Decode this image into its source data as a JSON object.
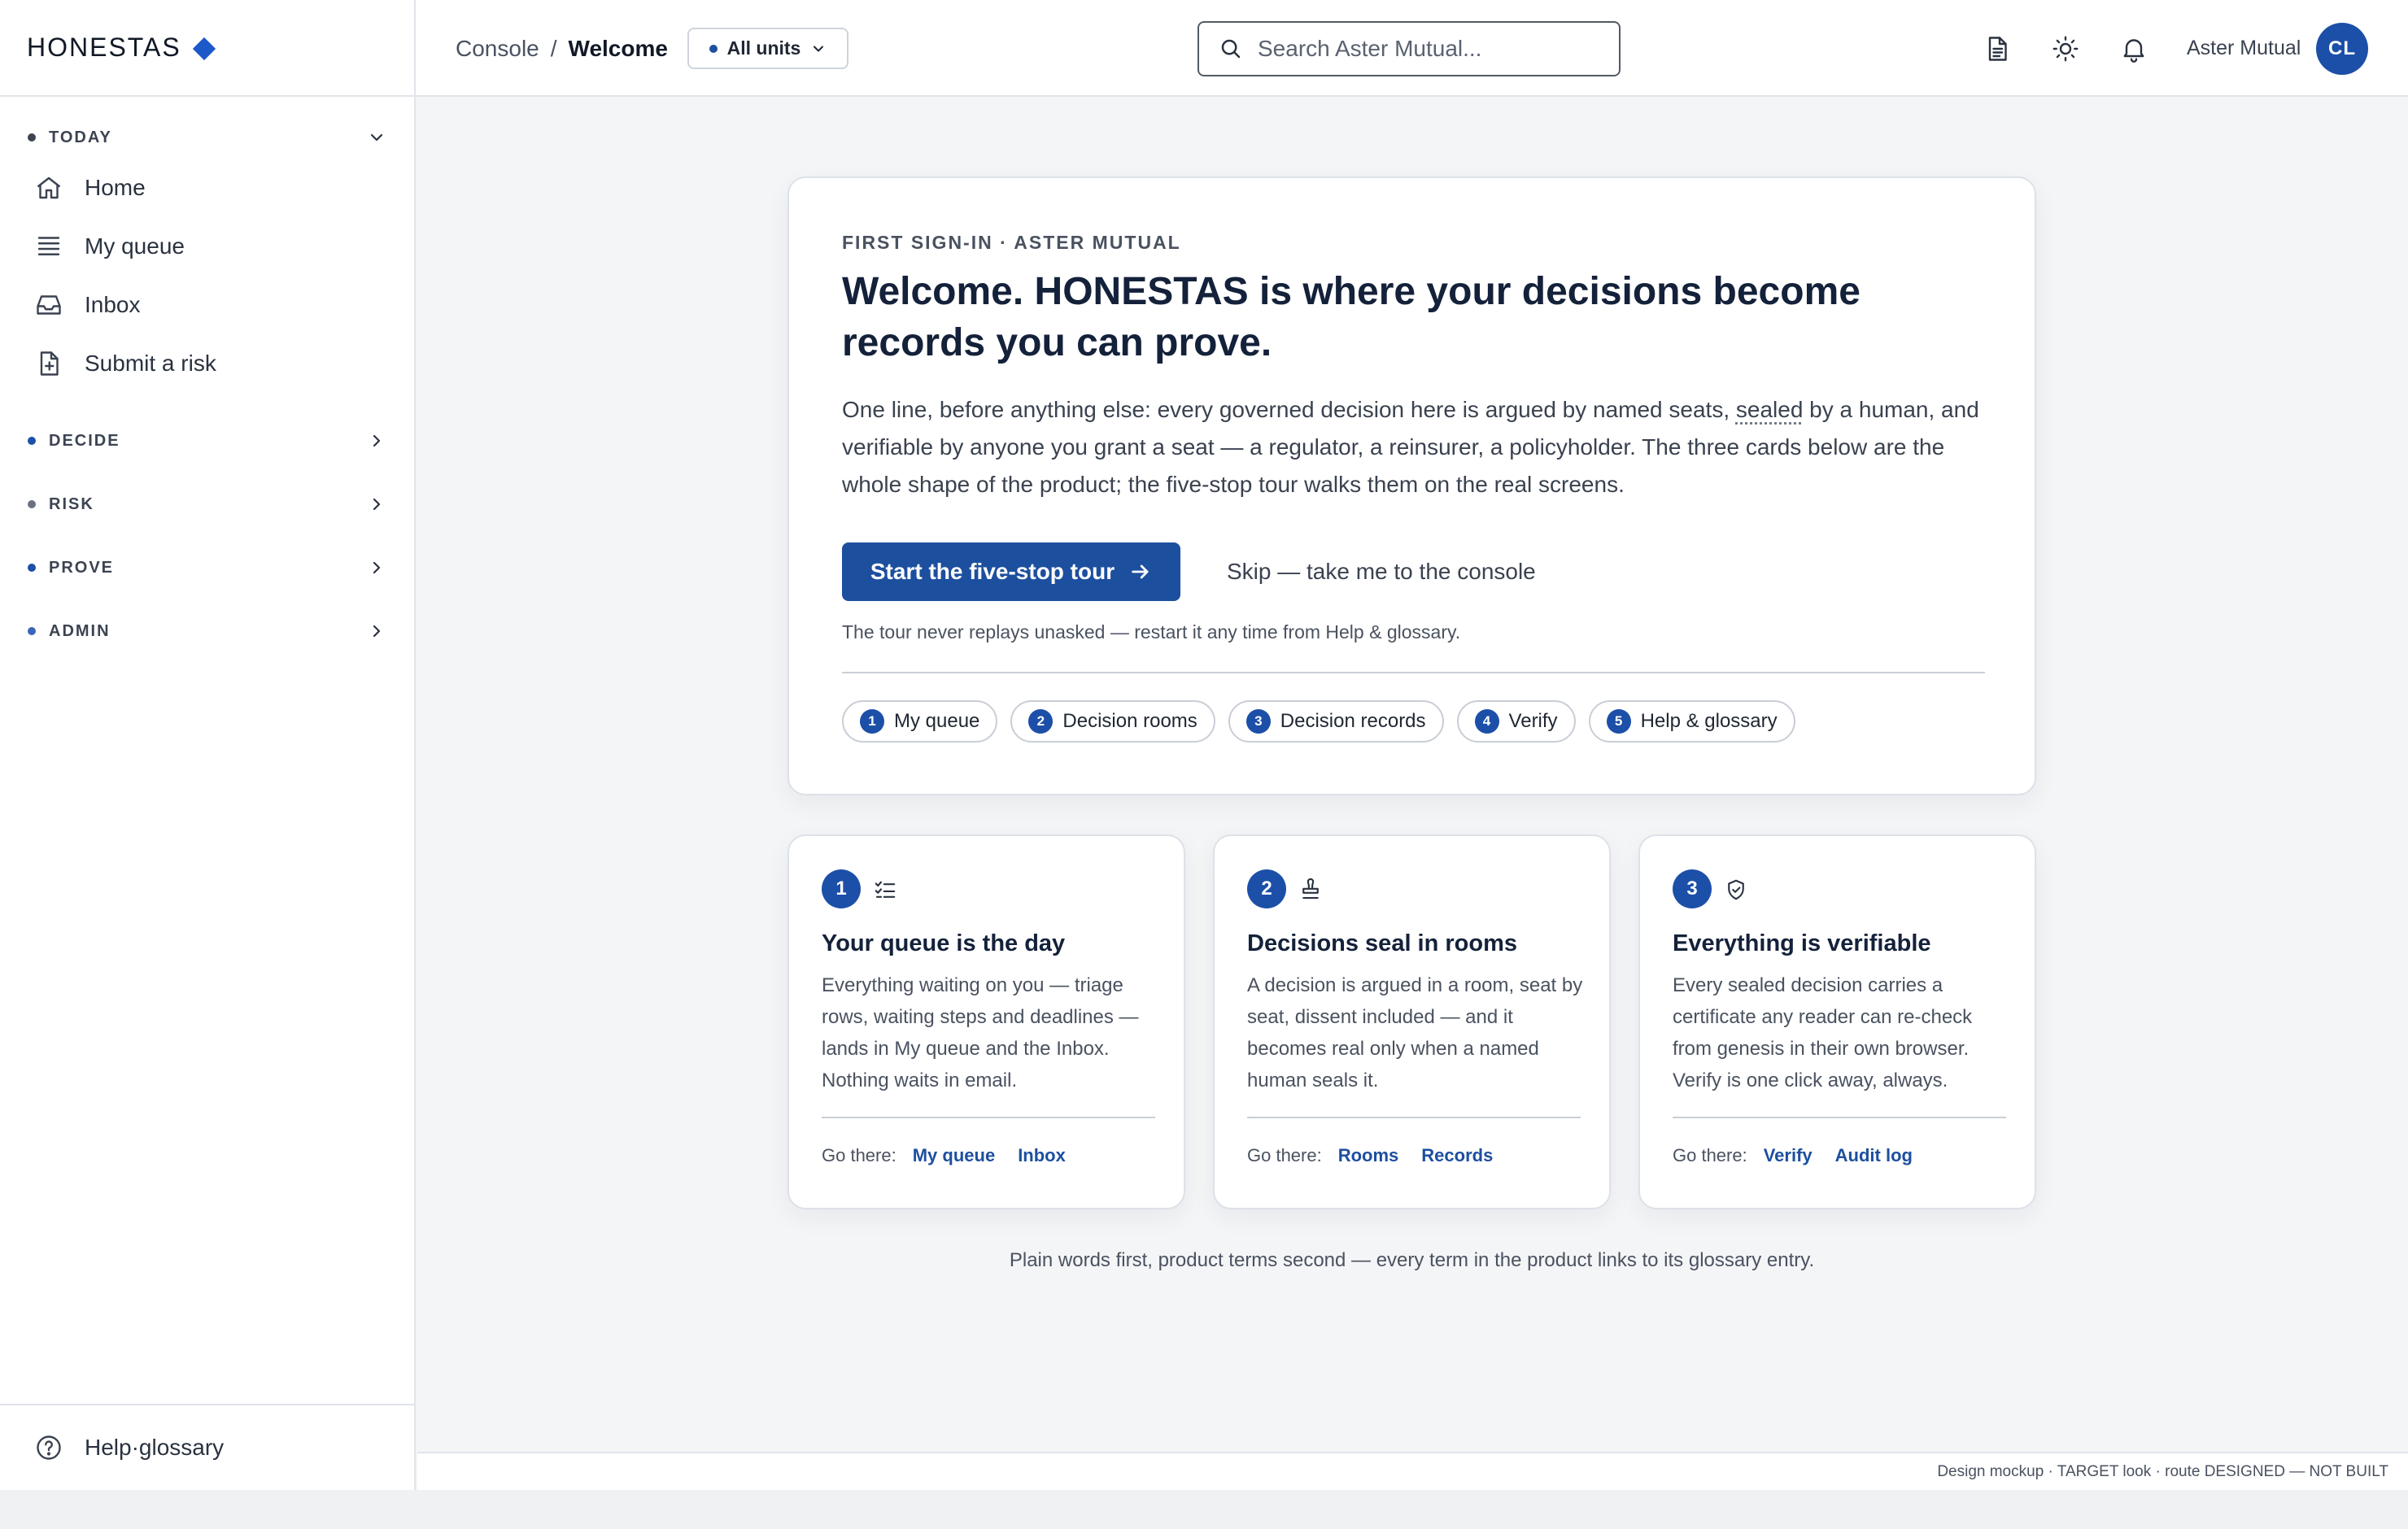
{
  "brand": {
    "name": "HONESTAS",
    "accent": "#1c58c8"
  },
  "sidebar": {
    "sections": [
      {
        "label": "TODAY",
        "dot_color": "#3c4452",
        "expanded": true,
        "items": [
          {
            "label": "Home",
            "icon": "home-icon"
          },
          {
            "label": "My queue",
            "icon": "queue-icon"
          },
          {
            "label": "Inbox",
            "icon": "inbox-icon"
          },
          {
            "label": "Submit a risk",
            "icon": "file-plus-icon"
          }
        ]
      },
      {
        "label": "DECIDE",
        "dot_color": "#1c4fa8",
        "expanded": false
      },
      {
        "label": "RISK",
        "dot_color": "#6a7280",
        "expanded": false
      },
      {
        "label": "PROVE",
        "dot_color": "#1c4fa8",
        "expanded": false
      },
      {
        "label": "ADMIN",
        "dot_color": "#3a66b8",
        "expanded": false
      }
    ],
    "footer": {
      "label": "Help·glossary",
      "icon": "help-circle-icon"
    }
  },
  "header": {
    "breadcrumb": {
      "root": "Console",
      "separator": "/",
      "current": "Welcome"
    },
    "unit_select": {
      "value": "All units"
    },
    "search": {
      "placeholder": "Search Aster Mutual..."
    },
    "icons": [
      "document-icon",
      "sun-icon",
      "bell-icon"
    ],
    "account": {
      "org": "Aster Mutual",
      "initials": "CL"
    }
  },
  "hero": {
    "eyebrow": "FIRST SIGN-IN · ASTER MUTUAL",
    "title": "Welcome. HONESTAS is where your decisions become records you can prove.",
    "body_before": "One line, before anything else: every governed decision here is argued by named seats, ",
    "body_term": "sealed",
    "body_after": " by a human, and verifiable by anyone you grant a seat — a regulator, a reinsurer, a policyholder. The three cards below are the whole shape of the product; the five-stop tour walks them on the real screens.",
    "cta_label": "Start the five-stop tour",
    "skip_label": "Skip — take me to the console",
    "tour_note": "The tour never replays unasked — restart it any time from Help & glossary.",
    "steps": [
      {
        "num": "1",
        "label": "My queue"
      },
      {
        "num": "2",
        "label": "Decision rooms"
      },
      {
        "num": "3",
        "label": "Decision records"
      },
      {
        "num": "4",
        "label": "Verify"
      },
      {
        "num": "5",
        "label": "Help & glossary"
      }
    ]
  },
  "cards": [
    {
      "num": "1",
      "icon": "checklist-icon",
      "title": "Your queue is the day",
      "body": "Everything waiting on you — triage rows, waiting steps and deadlines — lands in My queue and the Inbox. Nothing waits in email.",
      "go_label": "Go there:",
      "links": [
        "My queue",
        "Inbox"
      ]
    },
    {
      "num": "2",
      "icon": "stamp-icon",
      "title": "Decisions seal in rooms",
      "body": "A decision is argued in a room, seat by seat, dissent included — and it becomes real only when a named human seals it.",
      "go_label": "Go there:",
      "links": [
        "Rooms",
        "Records"
      ]
    },
    {
      "num": "3",
      "icon": "shield-check-icon",
      "title": "Everything is verifiable",
      "body": "Every sealed decision carries a certificate any reader can re-check from genesis in their own browser. Verify is one click away, always.",
      "go_label": "Go there:",
      "links": [
        "Verify",
        "Audit log"
      ]
    }
  ],
  "footnote": "Plain words first, product terms second — every term in the product links to its glossary entry.",
  "statusbar": "Design mockup · TARGET look · route DESIGNED — NOT BUILT"
}
